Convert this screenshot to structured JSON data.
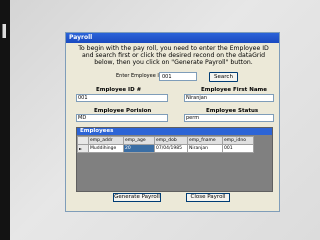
{
  "window": {
    "title": "Payroll"
  },
  "instructions": "To begin with the pay roll, you need to enter the Employee ID and search first or click the desired recond on the dataGrid below, then you click on \"Generate Payroll\" button.",
  "emp_id": {
    "label": "Enter Employee ID :",
    "value": "001"
  },
  "search_label": "Search",
  "fields": {
    "employee_id": {
      "label": "Employee ID #",
      "value": "001"
    },
    "first_name": {
      "label": "Employee First Name",
      "value": "Niranjan"
    },
    "position": {
      "label": "Employee Porision",
      "value": "MD"
    },
    "status": {
      "label": "Employee Status",
      "value": "perm"
    }
  },
  "grid": {
    "caption": "Employees",
    "columns": [
      "emp_addr",
      "emp_age",
      "emp_dob",
      "emp_fname",
      "emp_idno"
    ],
    "rows": [
      {
        "indicator": "►",
        "cells": [
          "Muddihinge",
          "20",
          "07/04/1985",
          "Niranjan",
          "001"
        ]
      }
    ]
  },
  "buttons": {
    "generate": "Generate Payroll",
    "close": "Close Payroll"
  },
  "colors": {
    "titlebar": "#1a4ac0",
    "grid_caption": "#2c64d6",
    "selection": "#3a6ea5"
  }
}
